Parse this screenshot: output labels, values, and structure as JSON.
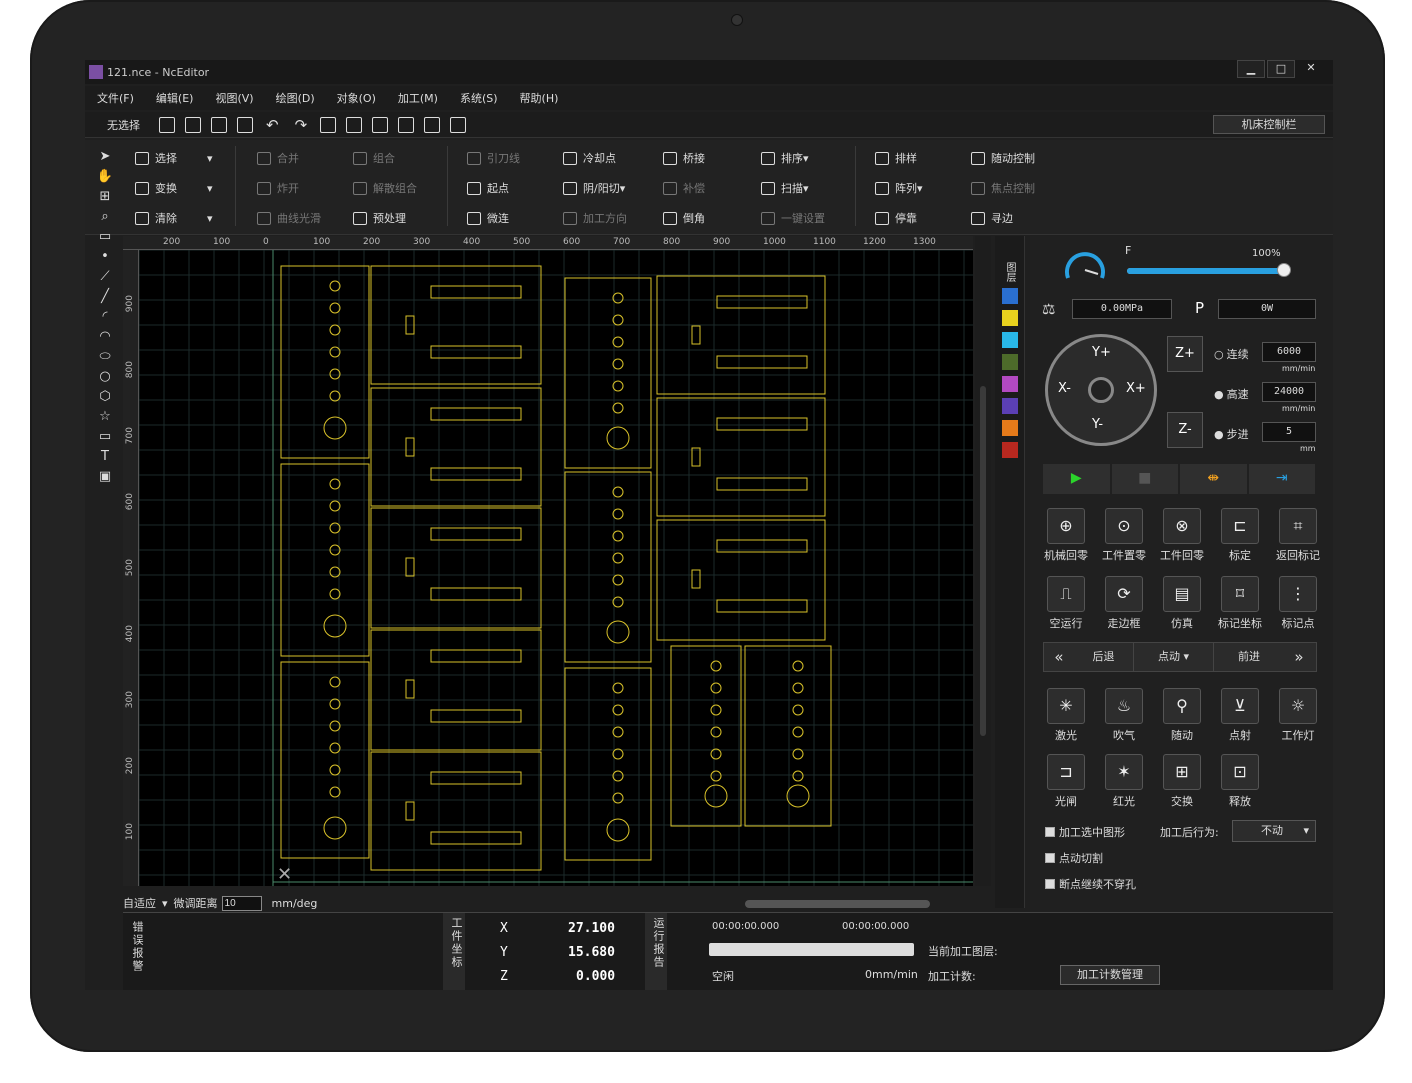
{
  "window": {
    "title": "121.nce - NcEditor",
    "controls": [
      "▁",
      "□",
      "✕"
    ]
  },
  "menu": [
    "文件(F)",
    "编辑(E)",
    "视图(V)",
    "绘图(D)",
    "对象(O)",
    "加工(M)",
    "系统(S)",
    "帮助(H)"
  ],
  "quickbar": {
    "selection": "无选择",
    "machine_panel": "机床控制栏"
  },
  "ribbon": {
    "select": "选择",
    "transform": "变换",
    "clear": "清除",
    "merge": "合并",
    "explode": "炸开",
    "smooth": "曲线光滑",
    "group": "组合",
    "ungroup": "解散组合",
    "preprocess": "预处理",
    "lead": "引刀线",
    "start": "起点",
    "microjoint": "微连",
    "cooling": "冷却点",
    "yinyang": "阴/阳切",
    "direction": "加工方向",
    "bridge": "桥接",
    "compensate": "补偿",
    "chamfer": "倒角",
    "sort": "排序",
    "scan": "扫描",
    "onekey": "一键设置",
    "nest": "排样",
    "array": "阵列",
    "stop": "停靠",
    "follow": "随动控制",
    "focus": "焦点控制",
    "find_edge": "寻边"
  },
  "ruler_top": [
    "200",
    "100",
    "0",
    "100",
    "200",
    "300",
    "400",
    "500",
    "600",
    "700",
    "800",
    "900",
    "1000",
    "1100",
    "1200",
    "1300"
  ],
  "ruler_left": [
    "900",
    "800",
    "700",
    "600",
    "500",
    "400",
    "300",
    "200",
    "100"
  ],
  "layers": {
    "title": "图层",
    "colors": [
      "#2a6fd0",
      "#e8d21e",
      "#29b8e8",
      "#4d6b2a",
      "#b249c1",
      "#5b3fb5",
      "#e57a1a",
      "#b8281f"
    ]
  },
  "bottom": {
    "fit": "自适应",
    "micro_label": "微调距离",
    "micro_value": "10",
    "unit": "mm/deg"
  },
  "status": {
    "error_label": "错误报警",
    "coord_label": "工件坐标",
    "x_label": "X",
    "y_label": "Y",
    "z_label": "Z",
    "x": "27.100",
    "y": "15.680",
    "z": "0.000",
    "run_label": "运行报告",
    "time1": "00:00:00.000",
    "time2": "00:00:00.000",
    "state": "空闲",
    "speed": "0mm/min",
    "layer_label": "当前加工图层:",
    "count_label": "加工计数:",
    "count_button": "加工计数管理"
  },
  "panel": {
    "f_label": "F",
    "f_percent": "100%",
    "f_level": 1.0,
    "pressure": "0.00MPa",
    "p_label": "P",
    "p_value": "0W",
    "jog": {
      "yp": "Y+",
      "ym": "Y-",
      "xp": "X+",
      "xm": "X-",
      "zp": "Z+",
      "zm": "Z-"
    },
    "modes": [
      {
        "label": "连续",
        "value": "6000",
        "unit": "mm/min"
      },
      {
        "label": "高速",
        "value": "24000",
        "unit": "mm/min"
      },
      {
        "label": "步进",
        "value": "5",
        "unit": "mm"
      }
    ],
    "tools1": [
      "机械回零",
      "工件置零",
      "工件回零",
      "标定",
      "返回标记"
    ],
    "tools2": [
      "空运行",
      "走边框",
      "仿真",
      "标记坐标",
      "标记点"
    ],
    "nav": {
      "back": "后退",
      "mode": "点动",
      "forward": "前进"
    },
    "tools3": [
      "激光",
      "吹气",
      "随动",
      "点射",
      "工作灯"
    ],
    "tools4": [
      "光闸",
      "红光",
      "交换",
      "释放"
    ],
    "opt_selected": "加工选中图形",
    "opt_after": "加工后行为:",
    "opt_after_value": "不动",
    "opt_jog_cut": "点动切割",
    "opt_breakpoint": "断点继续不穿孔"
  }
}
